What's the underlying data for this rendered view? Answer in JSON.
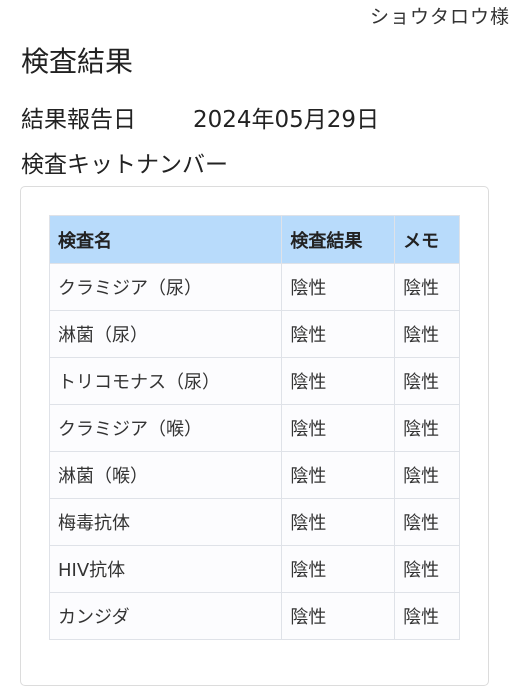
{
  "header": {
    "user_name": "ショウタロウ様"
  },
  "page": {
    "title": "検査結果",
    "report_date_label": "結果報告日",
    "report_date_value": "2024年05月29日",
    "kit_number_label": "検査キットナンバー"
  },
  "table": {
    "columns": [
      "検査名",
      "検査結果",
      "メモ"
    ],
    "header_color": "#b8dbfb",
    "rows": [
      {
        "name": "クラミジア（尿）",
        "result": "陰性",
        "memo": "陰性"
      },
      {
        "name": "淋菌（尿）",
        "result": "陰性",
        "memo": "陰性"
      },
      {
        "name": "トリコモナス（尿）",
        "result": "陰性",
        "memo": "陰性"
      },
      {
        "name": "クラミジア（喉）",
        "result": "陰性",
        "memo": "陰性"
      },
      {
        "name": "淋菌（喉）",
        "result": "陰性",
        "memo": "陰性"
      },
      {
        "name": "梅毒抗体",
        "result": "陰性",
        "memo": "陰性"
      },
      {
        "name": "HIV抗体",
        "result": "陰性",
        "memo": "陰性"
      },
      {
        "name": "カンジダ",
        "result": "陰性",
        "memo": "陰性"
      }
    ]
  }
}
